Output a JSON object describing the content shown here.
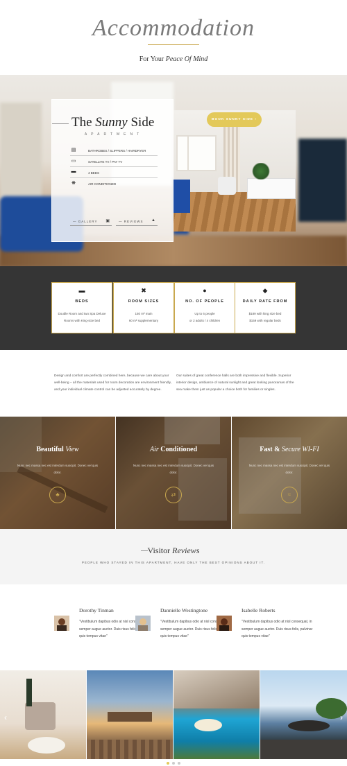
{
  "header": {
    "title": "Accommodation",
    "subtitle_prefix": "For Your ",
    "subtitle_italic": "Peace Of Mind",
    "accent_color": "#c9a84f"
  },
  "hero": {
    "title_prefix": "The ",
    "title_italic": "Sunny",
    "title_suffix": " Side",
    "subtitle": "APARTMENT",
    "features": [
      {
        "icon": "bathtub-icon",
        "label": "BATHROBES / SLIPPERS / HAIRDRYER"
      },
      {
        "icon": "tv-icon",
        "label": "SATELLITE TV / PAY TV"
      },
      {
        "icon": "bed-icon",
        "label": "4 BEDS"
      },
      {
        "icon": "snowflake-icon",
        "label": "AIR CONDITIONED"
      }
    ],
    "gallery_label": "GALLERY",
    "reviews_label": "REVIEWS",
    "book_button": "BOOK SUNNY SIDE",
    "book_color": "#e3c95a"
  },
  "stats": [
    {
      "icon": "bed-icon",
      "title": "BEDS",
      "line1": "Double Room and two Spa Deluxe",
      "line2": "Rooms with King-size bed"
    },
    {
      "icon": "expand-icon",
      "title": "ROOM SIZES",
      "line1": "150 m² main",
      "line2": "60 m² supplementary"
    },
    {
      "icon": "person-icon",
      "title": "NO. OF PEOPLE",
      "line1": "Up to 6 people",
      "line2": "or 2 adults / 4 children"
    },
    {
      "icon": "tag-icon",
      "title": "DAILY RATE FROM",
      "line1": "$189 with king size bed",
      "line2": "$159 with regular beds"
    }
  ],
  "description": {
    "left": "Design and comfort are perfectly combined here, because we care about your well-being – all the materials used for room decoration are environment friendly, and your individual climate control can be adjusted accurately by degree.",
    "right": "Our suites of great conference halls are both impressive and flexible. Superior interior design, ambiance of natural sunlight and great looking panoramas of the sea make them just as popular a choice both for families or singles."
  },
  "highlights": [
    {
      "title_bold": "Beautiful ",
      "title_italic": "View",
      "text": "Nunc nec massa nec est interdum suscipit. Donec vel quis dolor.",
      "icon": "leaf-icon"
    },
    {
      "title_bold": "",
      "title_italic": "Air",
      "title_rest": " Conditioned",
      "text": "Nunc nec massa nec est interdum suscipit. Donec vel quis dolor.",
      "icon": "toggle-icon"
    },
    {
      "title_bold": "Fast & ",
      "title_italic": "Secure WI-FI",
      "text": "Nunc nec massa nec est interdum suscipit. Donec vel quis dolor.",
      "icon": "wifi-icon"
    }
  ],
  "reviews_section": {
    "title_prefix": "Visitor ",
    "title_italic": "Reviews",
    "subtitle": "PEOPLE WHO STAYED IN THIS APARTMENT, HAVE ONLY THE BEST OPINIONS ABOUT IT."
  },
  "reviews": [
    {
      "name": "Dorothy Tinman",
      "quote": "\"Vestibulum dapibus odio at nisl consequat, in semper augue auctor. Duis risus felis, pulvinar quis tempus vitae\""
    },
    {
      "name": "Dannielle Westingtone",
      "quote": "\"Vestibulum dapibus odio at nisl consequat, in semper augue auctor. Duis risus felis, pulvinar quis tempus vitae\""
    },
    {
      "name": "Isabelle Roberts",
      "quote": "\"Vestibulum dapibus odio at nisl consequat, in semper augue auctor. Duis risus felis, pulvinar quis tempus vitae\""
    }
  ],
  "gallery": {
    "prev_icon": "chevron-left-icon",
    "next_icon": "chevron-right-icon"
  }
}
